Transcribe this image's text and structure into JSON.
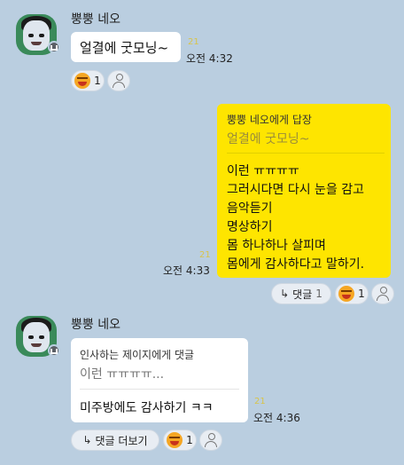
{
  "sender_name": "뿡뿡 네오",
  "msg1": {
    "text": "얼결에 굿모닝~",
    "unread": "21",
    "time": "오전 4:32",
    "reaction_count": "1"
  },
  "msg2": {
    "reply_header": "뿡뿡 네오에게 답장",
    "quoted": "얼결에 굿모닝~",
    "lines": [
      "이런 ㅠㅠㅠㅠ",
      "그러시다면 다시 눈을 감고",
      "음악듣기",
      "명상하기",
      "몸 하나하나 살피며",
      "몸에게 감사하다고 말하기."
    ],
    "unread": "21",
    "time": "오전 4:33",
    "reply_label": "댓글",
    "reply_count": "1",
    "reaction_count": "1"
  },
  "msg3": {
    "reply_header": "인사하는 제이지에게 댓글",
    "quoted": "이런 ㅠㅠㅠㅠ...",
    "text": "미주방에도 감사하기 ㅋㅋ",
    "unread": "21",
    "time": "오전 4:36",
    "more_label": "댓글 더보기",
    "reaction_count": "1"
  }
}
